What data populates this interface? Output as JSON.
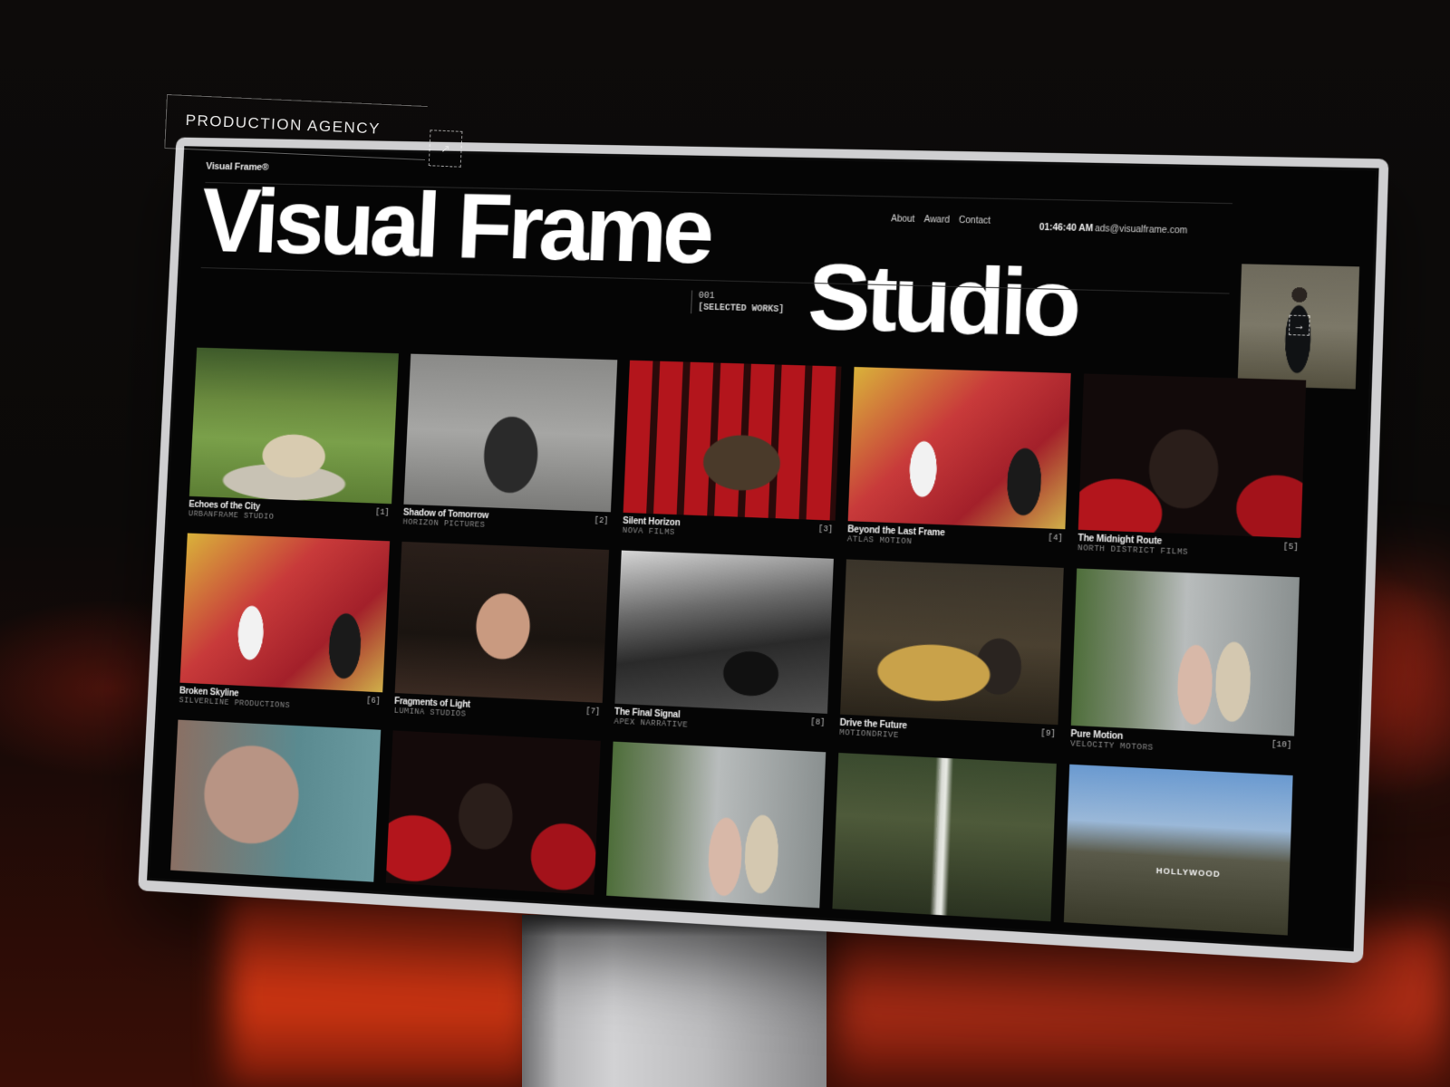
{
  "tag": {
    "label": "PRODUCTION AGENCY",
    "arrow": "↗"
  },
  "site": {
    "brand": "Visual Frame®",
    "hero_line1": "Visual Frame",
    "hero_line2": "Studio",
    "selected_num": "001",
    "selected_label": "[SELECTED WORKS]",
    "nav": [
      "About",
      "Award",
      "Contact"
    ],
    "clock": "01:46:40 AM",
    "email": "ads@visualframe.com",
    "thumb_arrow": "→"
  },
  "works": [
    {
      "title": "Echoes of the City",
      "studio": "URBANFRAME STUDIO",
      "num": "[1]",
      "image": "picnic"
    },
    {
      "title": "Shadow of Tomorrow",
      "studio": "HORIZON PICTURES",
      "num": "[2]",
      "image": "bw1"
    },
    {
      "title": "Silent Horizon",
      "studio": "NOVA FILMS",
      "num": "[3]",
      "image": "cinema"
    },
    {
      "title": "Beyond the Last Frame",
      "studio": "ATLAS MOTION",
      "num": "[4]",
      "image": "map"
    },
    {
      "title": "The Midnight Route",
      "studio": "NORTH DISTRICT FILMS",
      "num": "[5]",
      "image": "3d"
    },
    {
      "title": "Broken Skyline",
      "studio": "SILVERLINE PRODUCTIONS",
      "num": "[6]",
      "image": "map"
    },
    {
      "title": "Fragments of Light",
      "studio": "LUMINA STUDIOS",
      "num": "[7]",
      "image": "portrait"
    },
    {
      "title": "The Final Signal",
      "studio": "APEX NARRATIVE",
      "num": "[8]",
      "image": "car"
    },
    {
      "title": "Drive the Future",
      "studio": "MOTIONDRIVE",
      "num": "[9]",
      "image": "carcrash"
    },
    {
      "title": "Pure Motion",
      "studio": "VELOCITY MOTORS",
      "num": "[10]",
      "image": "couple"
    }
  ],
  "bottom_row": [
    "oldman",
    "3d2",
    "couple",
    "falls",
    "hills"
  ],
  "hollywood_sign": "HOLLYWOOD"
}
